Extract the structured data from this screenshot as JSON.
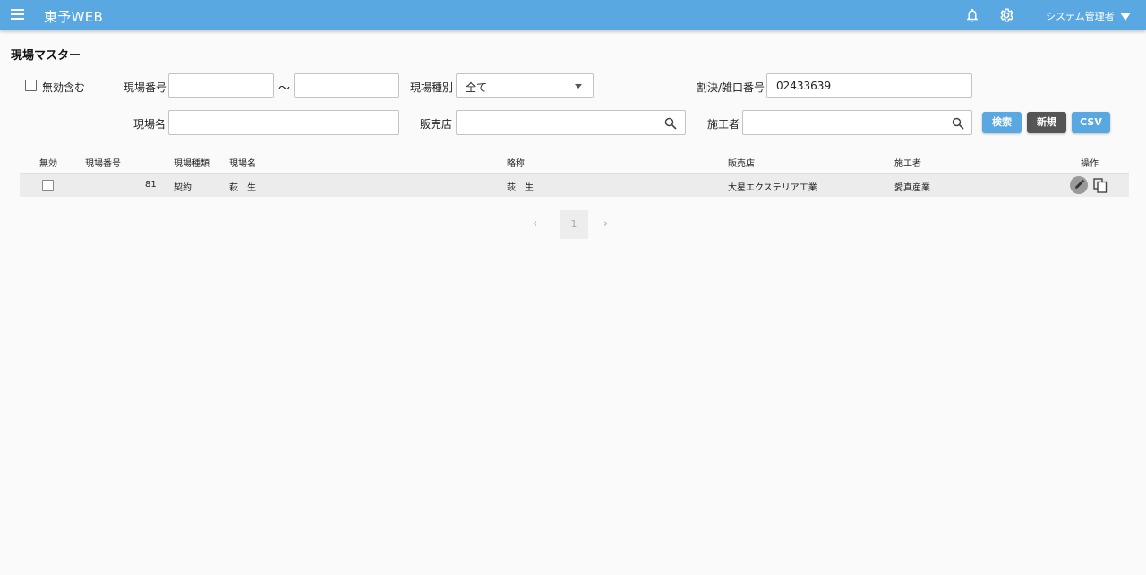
{
  "header": {
    "app_title": "東予WEB",
    "user_label": "システム管理者"
  },
  "page": {
    "title": "現場マスター"
  },
  "filters": {
    "include_invalid_label": "無効含む",
    "site_number_label": "現場番号",
    "range_sep": "〜",
    "site_number_from": "",
    "site_number_to": "",
    "site_type_label": "現場種別",
    "site_type_value": "全て",
    "split_number_label": "割決/雑口番号",
    "split_number_value": "02433639",
    "site_name_label": "現場名",
    "site_name_value": "",
    "dealer_label": "販売店",
    "dealer_value": "",
    "contractor_label": "施工者",
    "contractor_value": ""
  },
  "buttons": {
    "search": "検索",
    "new": "新規",
    "csv": "CSV"
  },
  "table": {
    "headers": [
      "無効",
      "現場番号",
      "現場種類",
      "現場名",
      "略称",
      "販売店",
      "施工者",
      "操作"
    ],
    "rows": [
      {
        "number": "81",
        "type": "契約",
        "name": "萩　生",
        "abbr": "萩　生",
        "dealer": "大星エクステリア工業",
        "contractor": "愛真産業"
      }
    ]
  },
  "pagination": {
    "prev": "‹",
    "current": "1",
    "next": "›"
  },
  "colors": {
    "header_bg": "#5aa8e2",
    "button_primary": "#5aa8e2",
    "button_dark": "#555555"
  }
}
